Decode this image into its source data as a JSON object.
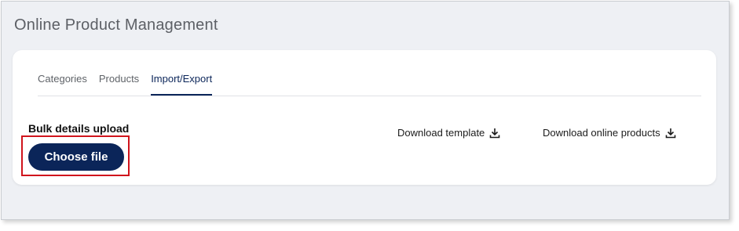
{
  "page": {
    "title": "Online Product Management"
  },
  "tabs": [
    {
      "label": "Categories",
      "active": false
    },
    {
      "label": "Products",
      "active": false
    },
    {
      "label": "Import/Export",
      "active": true
    }
  ],
  "bulk": {
    "title": "Bulk details upload",
    "choose_label": "Choose file"
  },
  "downloads": {
    "template_label": "Download template",
    "online_label": "Download online products",
    "icon": "download-icon"
  },
  "colors": {
    "accent": "#0b2559",
    "highlight_box": "#d0141c",
    "background": "#eef0f4"
  }
}
